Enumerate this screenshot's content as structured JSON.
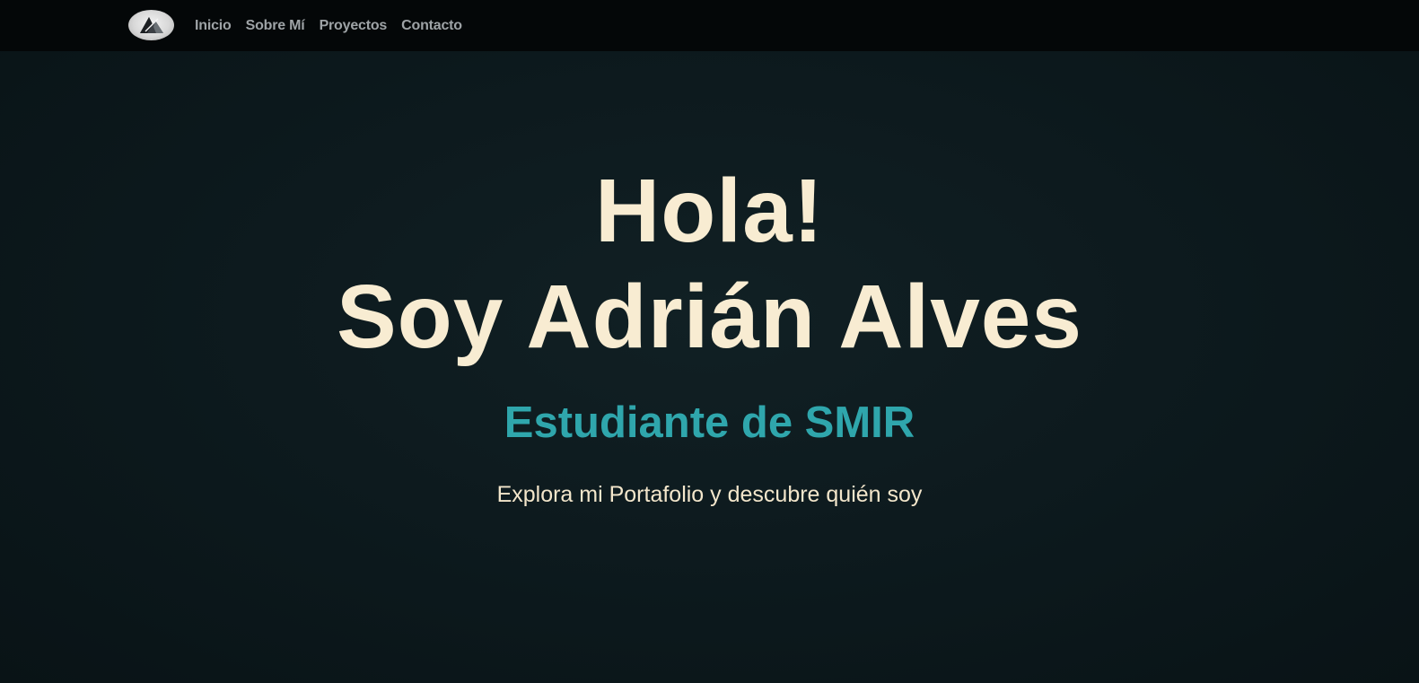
{
  "nav": {
    "logo_icon": "logo-mountain-icon",
    "links": [
      {
        "label": "Inicio"
      },
      {
        "label": "Sobre Mí"
      },
      {
        "label": "Proyectos"
      },
      {
        "label": "Contacto"
      }
    ]
  },
  "hero": {
    "greeting": "Hola!",
    "name_line": "Soy Adrián Alves",
    "role": "Estudiante de SMIR",
    "tagline": "Explora mi Portafolio y descubre quién soy"
  },
  "colors": {
    "background": "#0b1418",
    "navbar": "#040708",
    "title": "#f8ecd2",
    "accent": "#2fa6ac",
    "nav_text": "#9ea3a6"
  }
}
